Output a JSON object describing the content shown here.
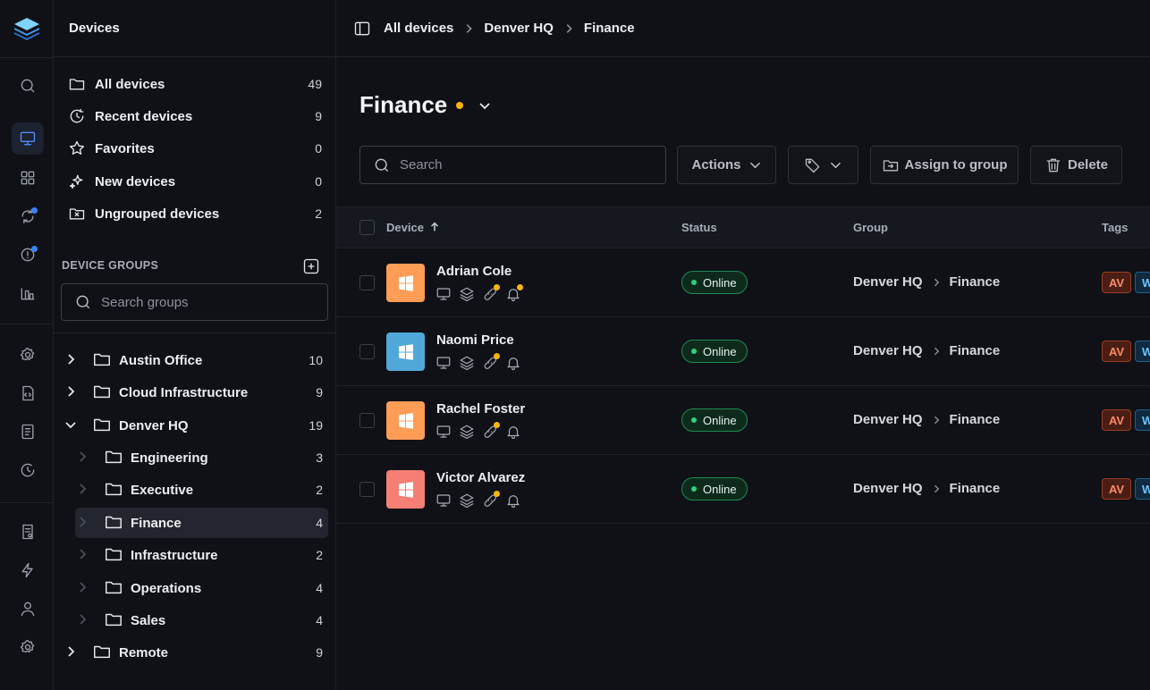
{
  "app": {
    "section_title": "Devices"
  },
  "rail": {
    "items": [
      "search-icon",
      "monitor-icon",
      "grid-icon",
      "sync-icon",
      "alert-icon",
      "chart-icon",
      "settings-gear-icon",
      "code-file-icon",
      "document-icon",
      "history-icon",
      "report-icon",
      "bolt-icon",
      "user-icon",
      "gear-icon"
    ],
    "active": "monitor-icon",
    "accent": "#4f8dff"
  },
  "sidebar": {
    "nav": [
      {
        "label": "All devices",
        "count": "49",
        "icon": "folder-icon"
      },
      {
        "label": "Recent devices",
        "count": "9",
        "icon": "recent-icon"
      },
      {
        "label": "Favorites",
        "count": "0",
        "icon": "star-icon"
      },
      {
        "label": "New devices",
        "count": "0",
        "icon": "sparkle-icon"
      },
      {
        "label": "Ungrouped devices",
        "count": "2",
        "icon": "folder-x-icon"
      }
    ],
    "groups_title": "DEVICE GROUPS",
    "group_search_placeholder": "Search groups",
    "tree": [
      {
        "label": "Austin Office",
        "count": "10"
      },
      {
        "label": "Cloud Infrastructure",
        "count": "9"
      },
      {
        "label": "Denver HQ",
        "count": "19"
      },
      {
        "label": "Engineering",
        "count": "3"
      },
      {
        "label": "Executive",
        "count": "2"
      },
      {
        "label": "Finance",
        "count": "4"
      },
      {
        "label": "Infrastructure",
        "count": "2"
      },
      {
        "label": "Operations",
        "count": "4"
      },
      {
        "label": "Sales",
        "count": "4"
      },
      {
        "label": "Remote",
        "count": "9"
      }
    ]
  },
  "breadcrumb": [
    "All devices",
    "Denver HQ",
    "Finance"
  ],
  "page": {
    "title": "Finance",
    "status_color": "#f5b50b",
    "search_placeholder": "Search",
    "actions_label": "Actions",
    "assign_label": "Assign to group",
    "delete_label": "Delete"
  },
  "table": {
    "columns": [
      "Device",
      "Status",
      "Group",
      "Tags"
    ],
    "rows": [
      {
        "name": "Adrian Cole",
        "status": "Online",
        "group": [
          "Denver HQ",
          "Finance"
        ],
        "tags": [
          "AV",
          "W"
        ],
        "color": "#ff9d57",
        "notify_dot": true
      },
      {
        "name": "Naomi Price",
        "status": "Online",
        "group": [
          "Denver HQ",
          "Finance"
        ],
        "tags": [
          "AV",
          "W"
        ],
        "color": "#4fa8d8",
        "notify_dot": false
      },
      {
        "name": "Rachel Foster",
        "status": "Online",
        "group": [
          "Denver HQ",
          "Finance"
        ],
        "tags": [
          "AV",
          "W"
        ],
        "color": "#ff9d57",
        "notify_dot": false
      },
      {
        "name": "Victor Alvarez",
        "status": "Online",
        "group": [
          "Denver HQ",
          "Finance"
        ],
        "tags": [
          "AV",
          "W"
        ],
        "color": "#f57f74",
        "notify_dot": false
      }
    ]
  }
}
